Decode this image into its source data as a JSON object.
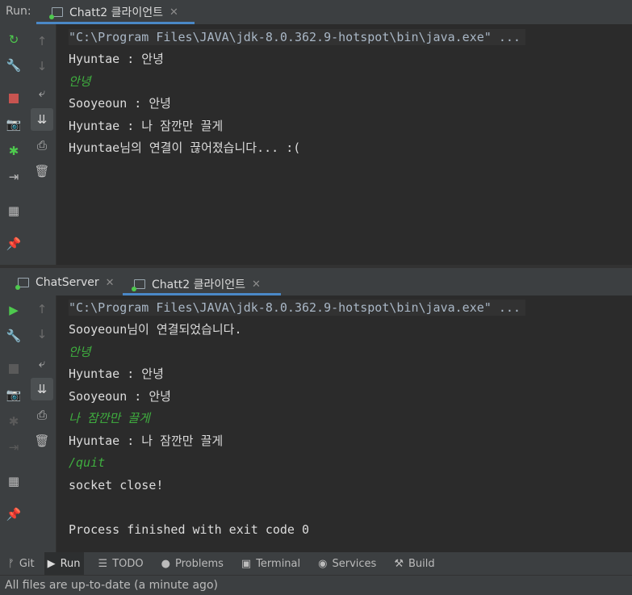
{
  "run_label": "Run:",
  "top": {
    "tab_title": "Chatt2 클라이언트",
    "lines": [
      {
        "kind": "cmd",
        "text": "\"C:\\Program Files\\JAVA\\jdk-8.0.362.9-hotspot\\bin\\java.exe\" ..."
      },
      {
        "kind": "normal",
        "text": "Hyuntae : 안녕"
      },
      {
        "kind": "input",
        "text": "안녕"
      },
      {
        "kind": "normal",
        "text": "Sooyeoun : 안녕"
      },
      {
        "kind": "normal",
        "text": "Hyuntae : 나 잠깐만 끌게"
      },
      {
        "kind": "normal",
        "text": "Hyuntae님의 연결이 끊어졌습니다... :("
      }
    ]
  },
  "bottom": {
    "tabs": [
      "ChatServer",
      "Chatt2 클라이언트"
    ],
    "lines": [
      {
        "kind": "cmd",
        "text": "\"C:\\Program Files\\JAVA\\jdk-8.0.362.9-hotspot\\bin\\java.exe\" ..."
      },
      {
        "kind": "normal",
        "text": "Sooyeoun님이 연결되었습니다."
      },
      {
        "kind": "input",
        "text": "안녕"
      },
      {
        "kind": "normal",
        "text": "Hyuntae : 안녕"
      },
      {
        "kind": "normal",
        "text": "Sooyeoun : 안녕"
      },
      {
        "kind": "input",
        "text": "나 잠깐만 끌게"
      },
      {
        "kind": "normal",
        "text": "Hyuntae : 나 잠깐만 끌게"
      },
      {
        "kind": "input",
        "text": "/quit"
      },
      {
        "kind": "normal",
        "text": "socket close!"
      },
      {
        "kind": "normal",
        "text": ""
      },
      {
        "kind": "normal",
        "text": "Process finished with exit code 0"
      }
    ]
  },
  "toolbar": [
    {
      "icon": "git-icon",
      "glyph": "ᚠ",
      "label": "Git"
    },
    {
      "icon": "run-icon",
      "glyph": "▶",
      "label": "Run"
    },
    {
      "icon": "todo-icon",
      "glyph": "☰",
      "label": "TODO"
    },
    {
      "icon": "problems-icon",
      "glyph": "●",
      "label": "Problems"
    },
    {
      "icon": "terminal-icon",
      "glyph": "▣",
      "label": "Terminal"
    },
    {
      "icon": "services-icon",
      "glyph": "◉",
      "label": "Services"
    },
    {
      "icon": "build-icon",
      "glyph": "🔨",
      "label": "Build"
    }
  ],
  "status_text": "All files are up-to-date (a minute ago)",
  "colors": {
    "accent": "#4a88c7",
    "input_green": "#3fae3f",
    "run_green": "#4ec94e",
    "stop_red": "#c75450"
  }
}
